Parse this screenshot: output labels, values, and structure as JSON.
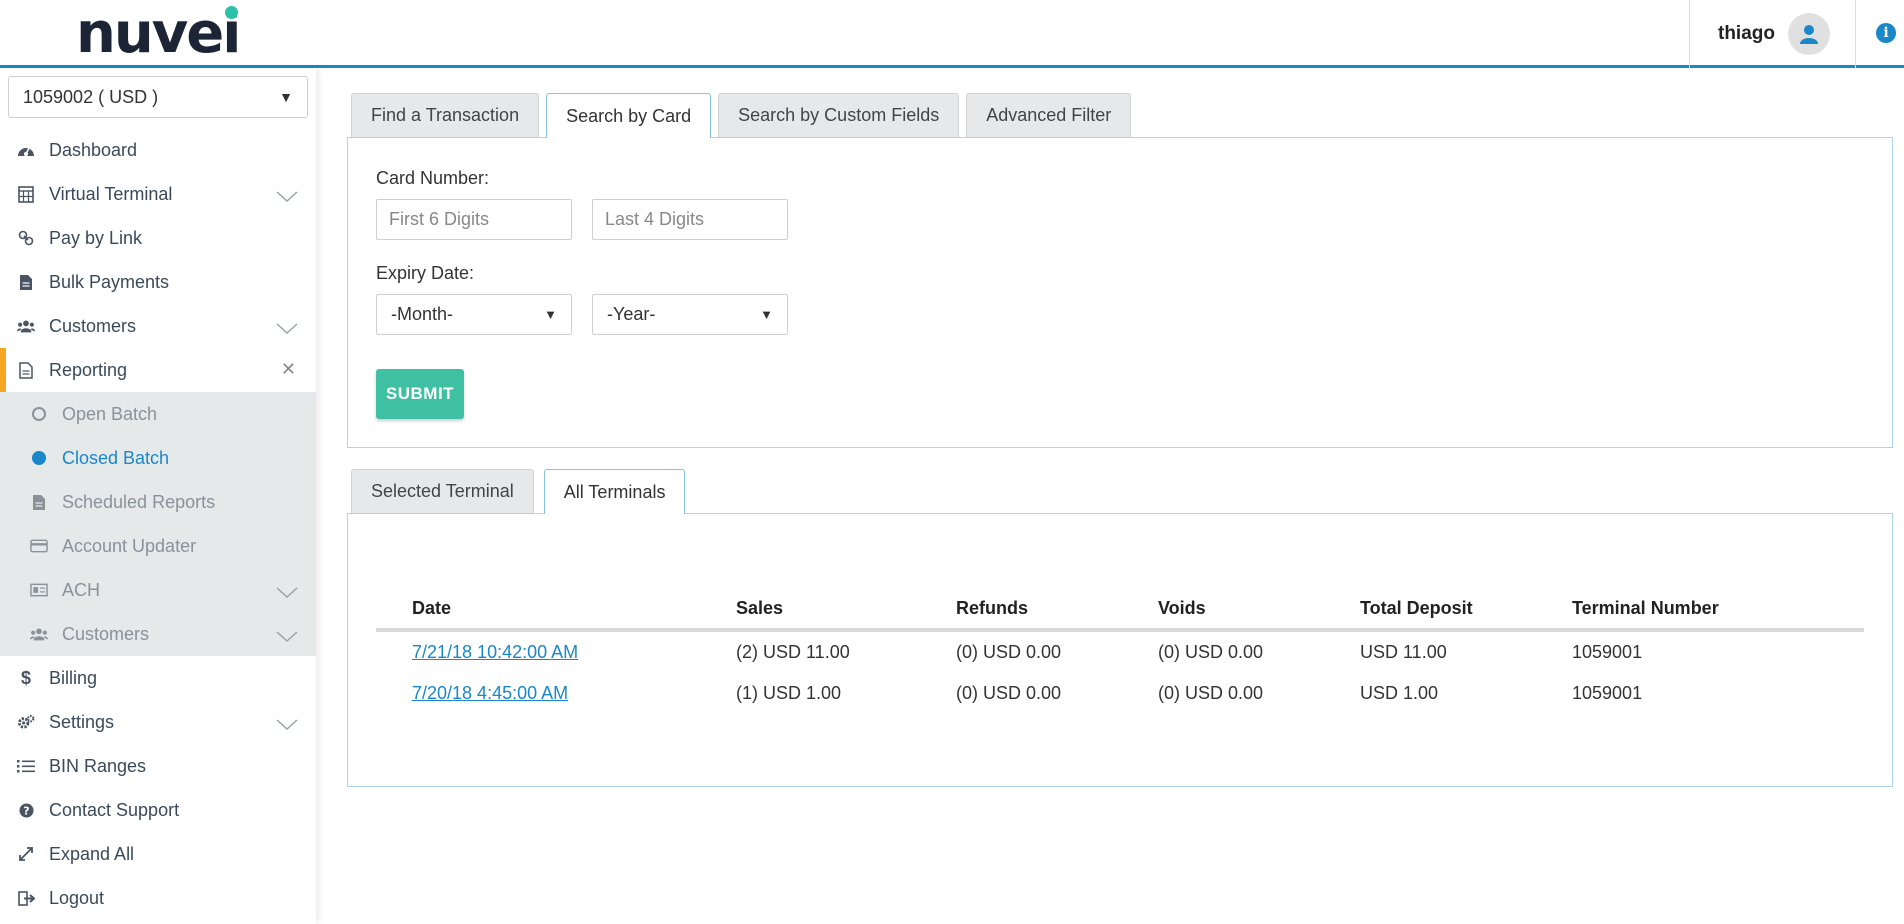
{
  "header": {
    "logo": "nuvei",
    "user_name": "thiago",
    "user_icon": "user-icon",
    "info_icon": "info-icon"
  },
  "sidebar": {
    "account_select": "1059002 ( USD )",
    "items": [
      {
        "label": "Dashboard",
        "icon": "dashboard-icon"
      },
      {
        "label": "Virtual Terminal",
        "icon": "calculator-icon",
        "expandable": true
      },
      {
        "label": "Pay by Link",
        "icon": "link-icon"
      },
      {
        "label": "Bulk Payments",
        "icon": "file-icon"
      },
      {
        "label": "Customers",
        "icon": "users-icon",
        "expandable": true
      },
      {
        "label": "Reporting",
        "icon": "report-icon",
        "active": true
      },
      {
        "label": "Billing",
        "icon": "dollar-icon"
      },
      {
        "label": "Settings",
        "icon": "cogs-icon",
        "expandable": true
      },
      {
        "label": "BIN Ranges",
        "icon": "list-icon"
      },
      {
        "label": "Contact Support",
        "icon": "question-icon"
      },
      {
        "label": "Expand All",
        "icon": "expand-icon"
      },
      {
        "label": "Logout",
        "icon": "logout-icon"
      }
    ],
    "reporting_sub": [
      {
        "label": "Open Batch",
        "icon": "radio-empty-icon"
      },
      {
        "label": "Closed Batch",
        "icon": "radio-filled-icon",
        "current": true
      },
      {
        "label": "Scheduled Reports",
        "icon": "file-icon"
      },
      {
        "label": "Account Updater",
        "icon": "credit-card-icon"
      },
      {
        "label": "ACH",
        "icon": "check-icon",
        "expandable": true
      },
      {
        "label": "Customers",
        "icon": "users-icon",
        "expandable": true
      }
    ]
  },
  "search_tabs": [
    "Find a Transaction",
    "Search by Card",
    "Search by Custom Fields",
    "Advanced Filter"
  ],
  "search_tab_active": "Search by Card",
  "card_form": {
    "card_number_label": "Card Number:",
    "first6_placeholder": "First 6 Digits",
    "last4_placeholder": "Last 4 Digits",
    "expiry_label": "Expiry Date:",
    "month_value": "-Month-",
    "year_value": "-Year-",
    "submit_label": "SUBMIT"
  },
  "terminal_tabs": [
    "Selected Terminal",
    "All Terminals"
  ],
  "terminal_tab_active": "All Terminals",
  "table": {
    "columns": [
      "Date",
      "Sales",
      "Refunds",
      "Voids",
      "Total Deposit",
      "Terminal Number"
    ],
    "rows": [
      {
        "date": "7/21/18 10:42:00 AM",
        "sales": "(2) USD 11.00",
        "refunds": "(0) USD 0.00",
        "voids": "(0) USD 0.00",
        "total_deposit": "USD 11.00",
        "terminal": "1059001"
      },
      {
        "date": "7/20/18 4:45:00 AM",
        "sales": "(1) USD 1.00",
        "refunds": "(0) USD 0.00",
        "voids": "(0) USD 0.00",
        "total_deposit": "USD 1.00",
        "terminal": "1059001"
      }
    ]
  },
  "colors": {
    "brand_blue": "#1a87c9",
    "accent_teal": "#3fc0a3",
    "active_marker": "#f5a623"
  }
}
